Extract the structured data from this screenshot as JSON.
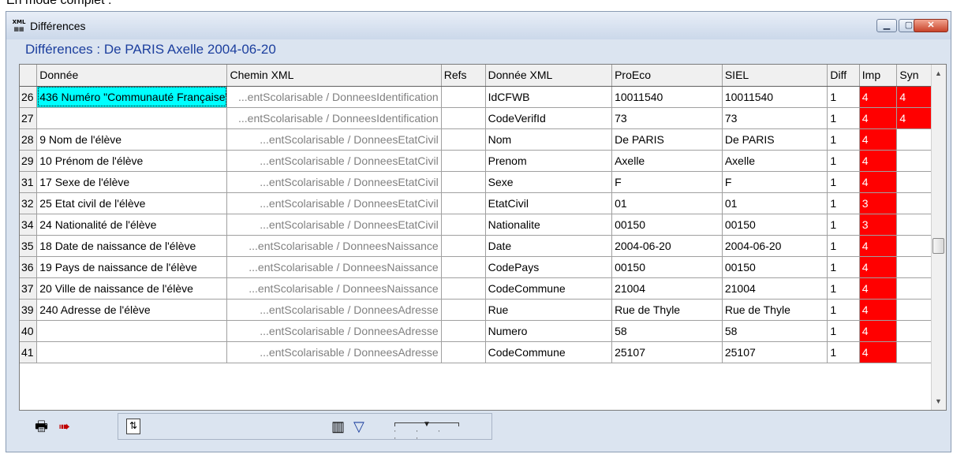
{
  "caption": "En mode complet :",
  "window": {
    "title": "Différences",
    "app_icon": "XML",
    "buttons": {
      "minimize": "▁",
      "maximize": "▢",
      "close": "✕"
    }
  },
  "subtitle": "Différences : De PARIS Axelle 2004-06-20",
  "columns": [
    "",
    "Donnée",
    "Chemin XML",
    "Refs",
    "Donnée XML",
    "ProEco",
    "SIEL",
    "Diff",
    "Imp",
    "Syn"
  ],
  "rows": [
    {
      "num": "26",
      "donnee": "436 Numéro \"Communauté Française\"",
      "chemin": "...entScolarisable / DonneesIdentification",
      "refs": "",
      "xml": "IdCFWB",
      "proeco": "10011540",
      "siel": "10011540",
      "diff": "1",
      "imp": "4",
      "syn": "4"
    },
    {
      "num": "27",
      "donnee": "",
      "chemin": "...entScolarisable / DonneesIdentification",
      "refs": "",
      "xml": "CodeVerifId",
      "proeco": "73",
      "siel": "73",
      "diff": "1",
      "imp": "4",
      "syn": "4"
    },
    {
      "num": "28",
      "donnee": "9 Nom de l'élève",
      "chemin": "...entScolarisable / DonneesEtatCivil",
      "refs": "",
      "xml": "Nom",
      "proeco": "De PARIS",
      "siel": "De PARIS",
      "diff": "1",
      "imp": "4",
      "syn": ""
    },
    {
      "num": "29",
      "donnee": "10 Prénom de l'élève",
      "chemin": "...entScolarisable / DonneesEtatCivil",
      "refs": "",
      "xml": "Prenom",
      "proeco": "Axelle",
      "siel": "Axelle",
      "diff": "1",
      "imp": "4",
      "syn": ""
    },
    {
      "num": "31",
      "donnee": "17 Sexe de l'élève",
      "chemin": "...entScolarisable / DonneesEtatCivil",
      "refs": "",
      "xml": "Sexe",
      "proeco": "F",
      "siel": "F",
      "diff": "1",
      "imp": "4",
      "syn": ""
    },
    {
      "num": "32",
      "donnee": "25 Etat civil de l'élève",
      "chemin": "...entScolarisable / DonneesEtatCivil",
      "refs": "",
      "xml": "EtatCivil",
      "proeco": "01",
      "siel": "01",
      "diff": "1",
      "imp": "3",
      "syn": ""
    },
    {
      "num": "34",
      "donnee": "24 Nationalité de l'élève",
      "chemin": "...entScolarisable / DonneesEtatCivil",
      "refs": "",
      "xml": "Nationalite",
      "proeco": "00150",
      "siel": "00150",
      "diff": "1",
      "imp": "3",
      "syn": ""
    },
    {
      "num": "35",
      "donnee": "18 Date de naissance de l'élève",
      "chemin": "...entScolarisable / DonneesNaissance",
      "refs": "",
      "xml": "Date",
      "proeco": "2004-06-20",
      "siel": "2004-06-20",
      "diff": "1",
      "imp": "4",
      "syn": ""
    },
    {
      "num": "36",
      "donnee": "19 Pays de naissance de l'élève",
      "chemin": "...entScolarisable / DonneesNaissance",
      "refs": "",
      "xml": "CodePays",
      "proeco": "00150",
      "siel": "00150",
      "diff": "1",
      "imp": "4",
      "syn": ""
    },
    {
      "num": "37",
      "donnee": "20 Ville de naissance de l'élève",
      "chemin": "...entScolarisable / DonneesNaissance",
      "refs": "",
      "xml": "CodeCommune",
      "proeco": "21004",
      "siel": "21004",
      "diff": "1",
      "imp": "4",
      "syn": ""
    },
    {
      "num": "39",
      "donnee": "240 Adresse de l'élève",
      "chemin": "...entScolarisable / DonneesAdresse",
      "refs": "",
      "xml": "Rue",
      "proeco": "Rue de Thyle",
      "siel": "Rue de Thyle",
      "diff": "1",
      "imp": "4",
      "syn": ""
    },
    {
      "num": "40",
      "donnee": "",
      "chemin": "...entScolarisable / DonneesAdresse",
      "refs": "",
      "xml": "Numero",
      "proeco": "58",
      "siel": "58",
      "diff": "1",
      "imp": "4",
      "syn": ""
    },
    {
      "num": "41",
      "donnee": "",
      "chemin": "...entScolarisable / DonneesAdresse",
      "refs": "",
      "xml": "CodeCommune",
      "proeco": "25107",
      "siel": "25107",
      "diff": "1",
      "imp": "4",
      "syn": ""
    }
  ],
  "toolbar": {
    "icons": [
      "printer-icon",
      "export-icon",
      "refresh-icon",
      "columns-icon",
      "filter-icon",
      "zoom-slider"
    ]
  },
  "colors": {
    "selected_cell": "#00ffff",
    "importance": "#ff0000",
    "subtitle": "#1c3f9e"
  }
}
